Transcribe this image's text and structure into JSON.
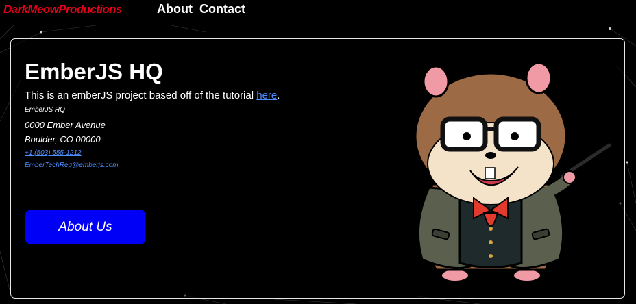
{
  "navbar": {
    "brand": "DarkMeowProductions",
    "links": [
      "About",
      "Contact"
    ]
  },
  "card": {
    "title": "EmberJS HQ",
    "intro_text": "This is an emberJS project based off of the tutorial ",
    "intro_link": "here",
    "intro_end": ".",
    "address": {
      "name": "EmberJS HQ",
      "street": "0000 Ember Avenue",
      "city": "Boulder, CO 00000",
      "phone": "+1 (503) 555-1212",
      "email": "EmberTechReg@emberjs.com"
    },
    "button_label": "About Us"
  },
  "mascot": {
    "icon": "tomster-hamster-mascot"
  },
  "colors": {
    "brand": "#e3001b",
    "link": "#4c8dff",
    "button": "#0000f6",
    "background": "#000000"
  }
}
